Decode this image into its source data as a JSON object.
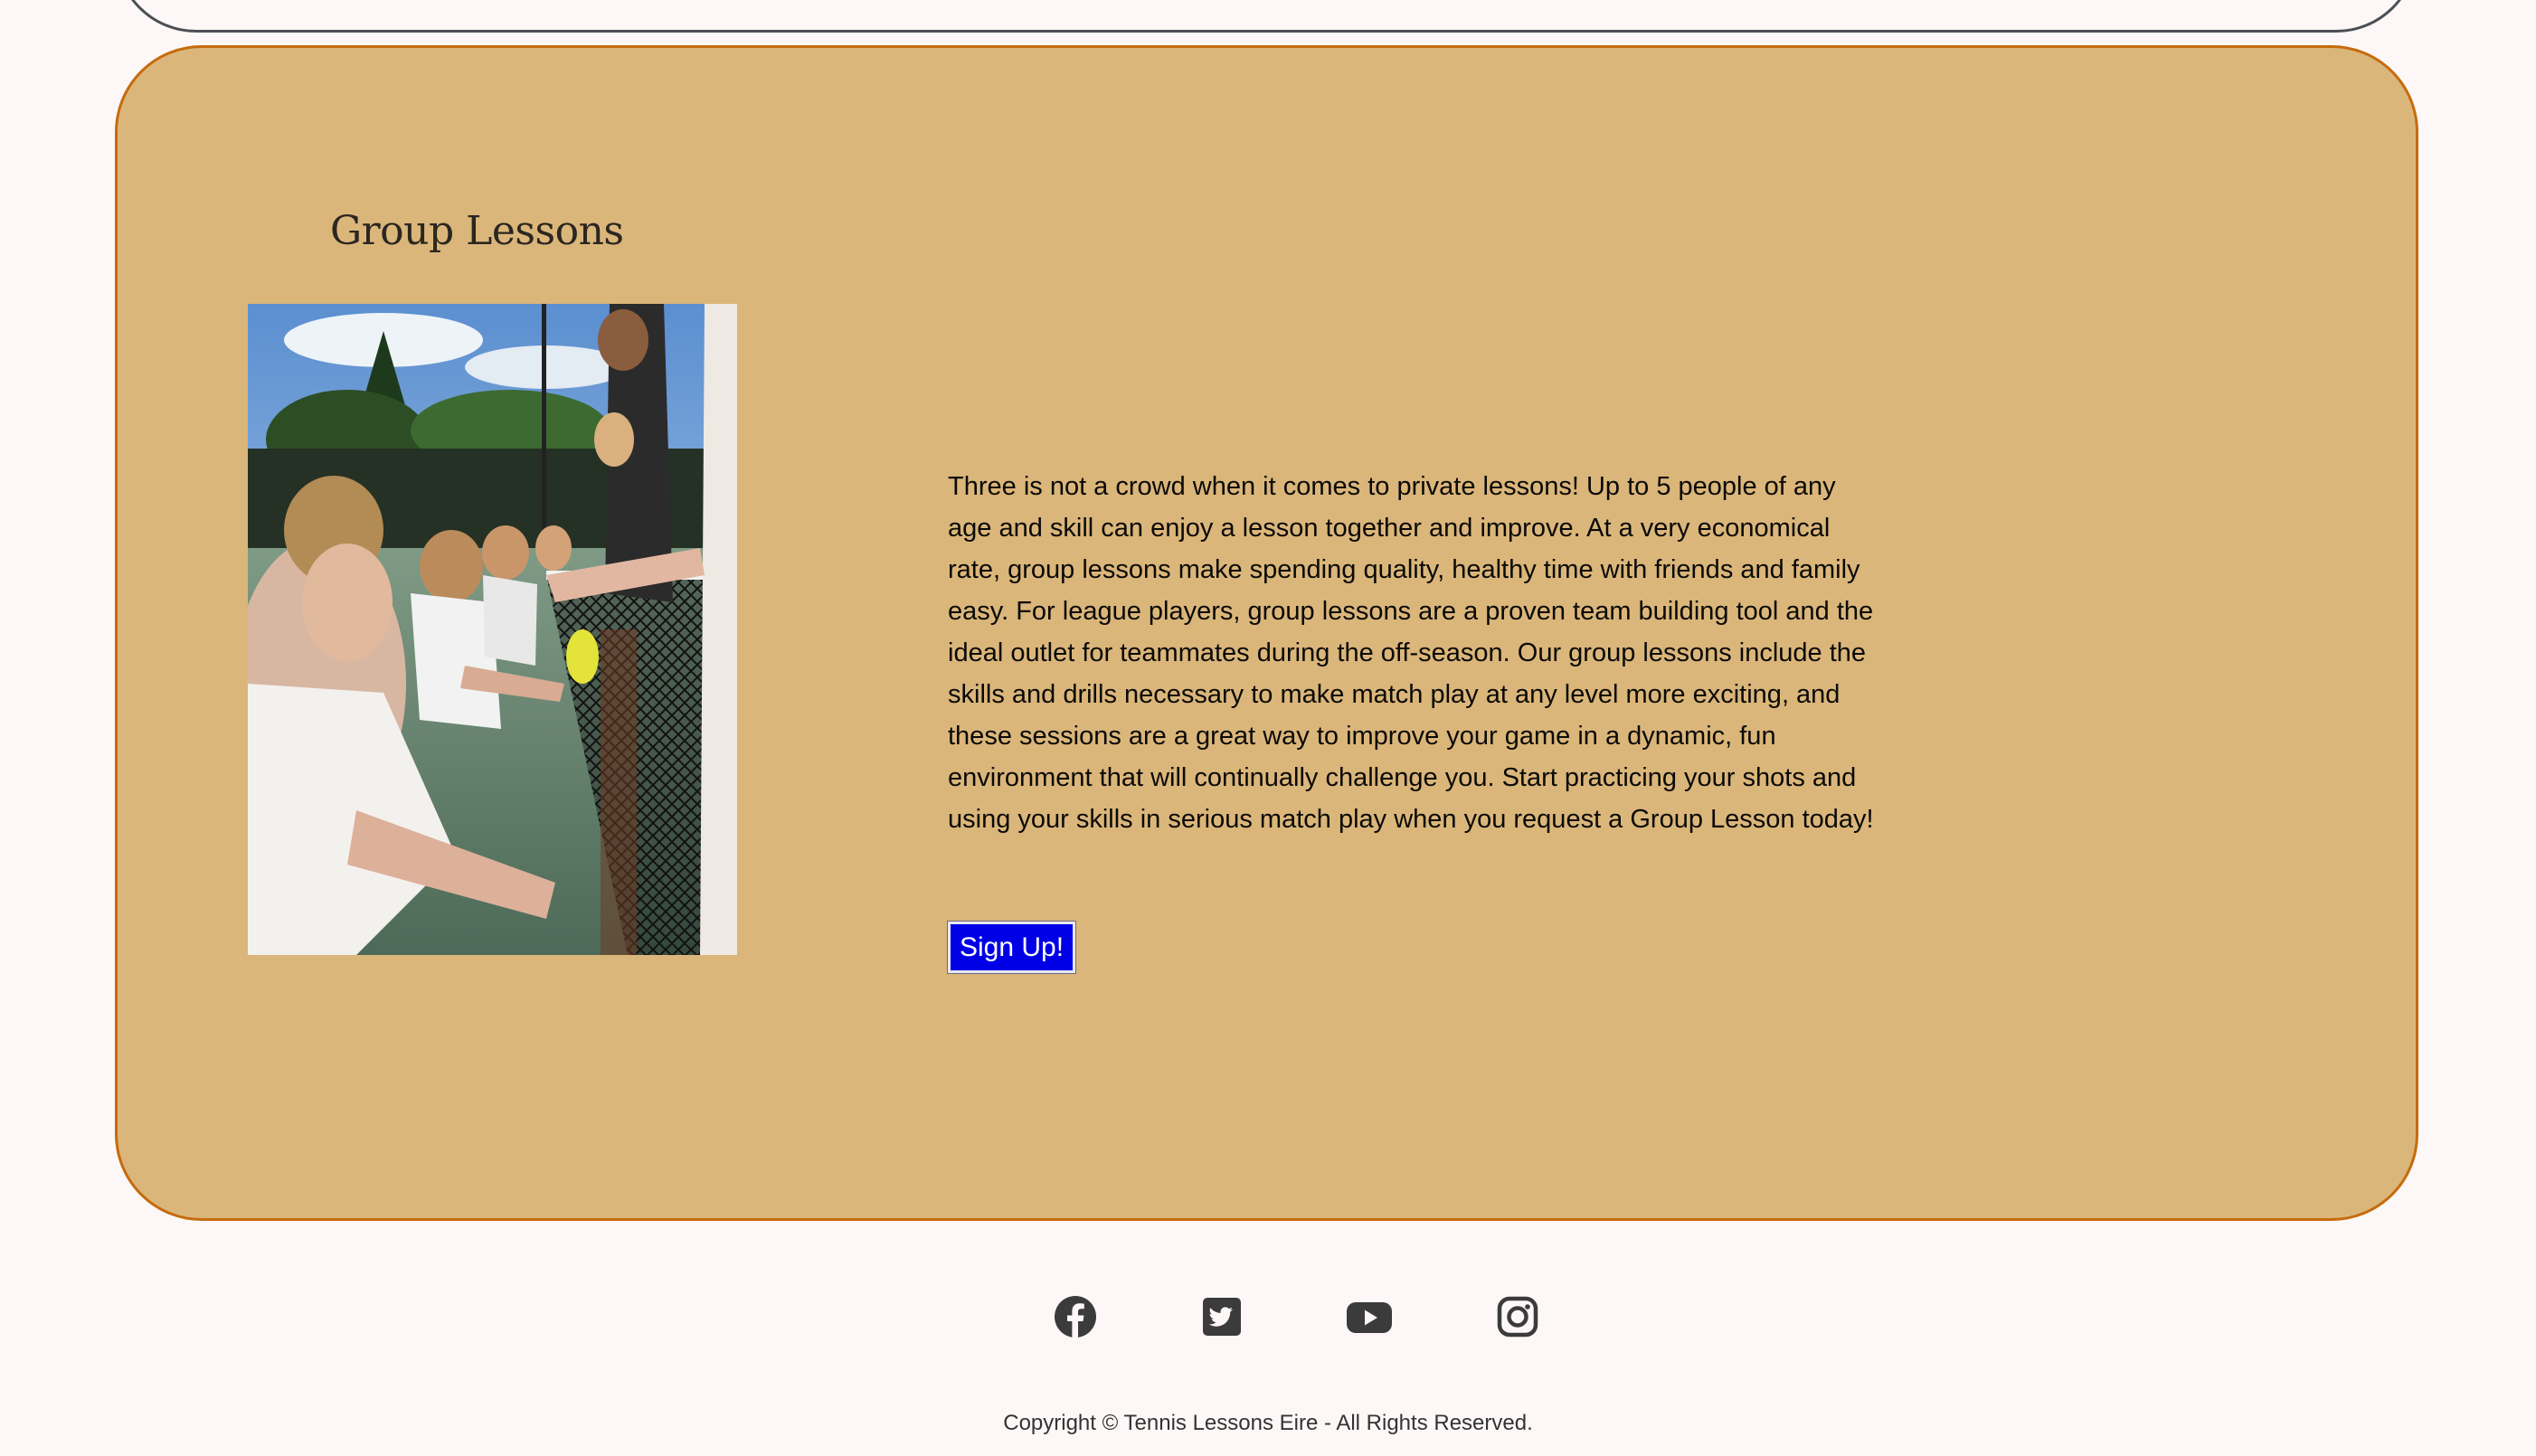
{
  "group_lessons": {
    "title": "Group Lessons",
    "image_alt": "Players practicing volleys at the net",
    "description": "Three is not a crowd when it comes to private lessons! Up to 5 people of any age and skill can enjoy a lesson together and improve. At a very economical rate, group lessons make spending quality, healthy time with friends and family easy. For league players, group lessons are a proven team building tool and the ideal outlet for teammates during the off-season. Our group lessons include the skills and drills necessary to make match play at any level more exciting, and these sessions are a great way to improve your game in a dynamic, fun environment that will continually challenge you. Start practicing your shots and using your skills in serious match play when you request a Group Lesson today!",
    "signup_label": "Sign Up!"
  },
  "footer": {
    "social": [
      {
        "name": "facebook-icon"
      },
      {
        "name": "twitter-icon"
      },
      {
        "name": "youtube-icon"
      },
      {
        "name": "instagram-icon"
      }
    ],
    "copyright": "Copyright © Tennis Lessons Eire - All Rights Reserved."
  },
  "colors": {
    "page_background": "#fdf8f7",
    "card_background": "#dbb67a",
    "card_border": "#c66b0e",
    "button_background": "#0000e6",
    "icon_color": "#3b3b3b"
  }
}
